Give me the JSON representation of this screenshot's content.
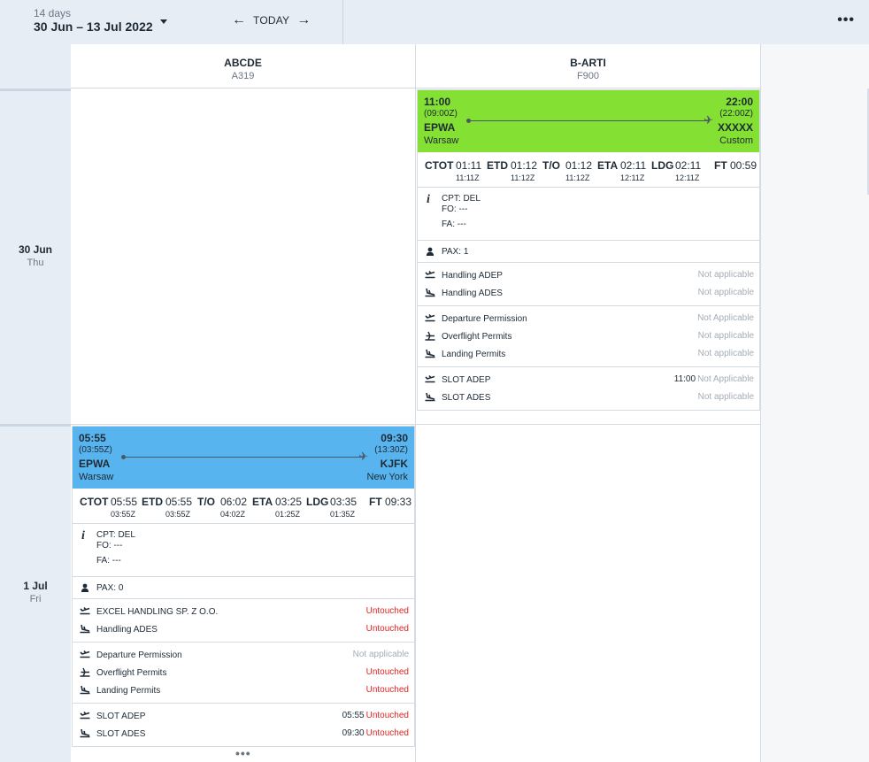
{
  "header": {
    "days_label": "14 days",
    "date_range": "30 Jun – 13 Jul 2022",
    "today_label": "TODAY",
    "prev_icon": "arrow-left-icon",
    "next_icon": "arrow-right-icon",
    "more_icon": "more-horizontal-icon"
  },
  "days": [
    {
      "date": "30 Jun",
      "weekday": "Thu"
    },
    {
      "date": "1 Jul",
      "weekday": "Fri"
    }
  ],
  "aircraft": [
    {
      "reg": "ABCDE",
      "type": "A319"
    },
    {
      "reg": "B-ARTI",
      "type": "F900"
    }
  ],
  "colors": {
    "green_header": "#84e032",
    "blue_header": "#58b4ee",
    "untouched": "#e02424",
    "muted": "#a4adb6"
  },
  "flights": [
    {
      "dep_time": "11:00",
      "dep_time_z": "(09:00Z)",
      "dep_ap": "EPWA",
      "dep_city": "Warsaw",
      "arr_time": "22:00",
      "arr_time_z": "(22:00Z)",
      "arr_ap": "XXXXX",
      "arr_city": "Custom",
      "times": {
        "ctot_label": "CTOT",
        "ctot": "01:11",
        "ctot_z": "11:11Z",
        "etd_label": "ETD",
        "etd": "01:12",
        "etd_z": "11:12Z",
        "to_label": "T/O",
        "to": "01:12",
        "to_z": "11:12Z",
        "eta_label": "ETA",
        "eta": "02:11",
        "eta_z": "12:11Z",
        "ldg_label": "LDG",
        "ldg": "02:11",
        "ldg_z": "12:11Z",
        "ft_label": "FT",
        "ft": "00:59"
      },
      "crew": {
        "info_icon": "info-icon",
        "cpt": "CPT: DEL",
        "fo": "FO: ---",
        "fa": "FA: ---"
      },
      "pax": {
        "icon": "person-icon",
        "label": "PAX: 1"
      },
      "handling": [
        {
          "icon": "takeoff-icon",
          "name": "Handling ADEP",
          "status": "Not applicable",
          "time": ""
        },
        {
          "icon": "landing-icon",
          "name": "Handling ADES",
          "status": "Not applicable",
          "time": ""
        }
      ],
      "permits": [
        {
          "icon": "takeoff-icon",
          "name": "Departure Permission",
          "status": "Not Applicable",
          "time": ""
        },
        {
          "icon": "overflight-icon",
          "name": "Overflight Permits",
          "status": "Not applicable",
          "time": ""
        },
        {
          "icon": "landing-icon",
          "name": "Landing Permits",
          "status": "Not applicable",
          "time": ""
        }
      ],
      "slots": [
        {
          "icon": "takeoff-icon",
          "name": "SLOT ADEP",
          "status": "Not Applicable",
          "time": "11:00"
        },
        {
          "icon": "landing-icon",
          "name": "SLOT ADES",
          "status": "Not applicable",
          "time": ""
        }
      ]
    },
    {
      "dep_time": "05:55",
      "dep_time_z": "(03:55Z)",
      "dep_ap": "EPWA",
      "dep_city": "Warsaw",
      "arr_time": "09:30",
      "arr_time_z": "(13:30Z)",
      "arr_ap": "KJFK",
      "arr_city": "New York",
      "times": {
        "ctot_label": "CTOT",
        "ctot": "05:55",
        "ctot_z": "03:55Z",
        "etd_label": "ETD",
        "etd": "05:55",
        "etd_z": "03:55Z",
        "to_label": "T/O",
        "to": "06:02",
        "to_z": "04:02Z",
        "eta_label": "ETA",
        "eta": "03:25",
        "eta_z": "01:25Z",
        "ldg_label": "LDG",
        "ldg": "03:35",
        "ldg_z": "01:35Z",
        "ft_label": "FT",
        "ft": "09:33"
      },
      "crew": {
        "info_icon": "info-icon",
        "cpt": "CPT: DEL",
        "fo": "FO: ---",
        "fa": "FA: ---"
      },
      "pax": {
        "icon": "person-icon",
        "label": "PAX: 0"
      },
      "handling": [
        {
          "icon": "takeoff-icon",
          "name": "EXCEL HANDLING SP. Z O.O.",
          "status": "Untouched",
          "time": ""
        },
        {
          "icon": "landing-icon",
          "name": "Handling ADES",
          "status": "Untouched",
          "time": ""
        }
      ],
      "permits": [
        {
          "icon": "takeoff-icon",
          "name": "Departure Permission",
          "status": "Not applicable",
          "time": ""
        },
        {
          "icon": "overflight-icon",
          "name": "Overflight Permits",
          "status": "Untouched",
          "time": ""
        },
        {
          "icon": "landing-icon",
          "name": "Landing Permits",
          "status": "Untouched",
          "time": ""
        }
      ],
      "slots": [
        {
          "icon": "takeoff-icon",
          "name": "SLOT ADEP",
          "status": "Untouched",
          "time": "05:55"
        },
        {
          "icon": "landing-icon",
          "name": "SLOT ADES",
          "status": "Untouched",
          "time": "09:30"
        }
      ]
    }
  ]
}
